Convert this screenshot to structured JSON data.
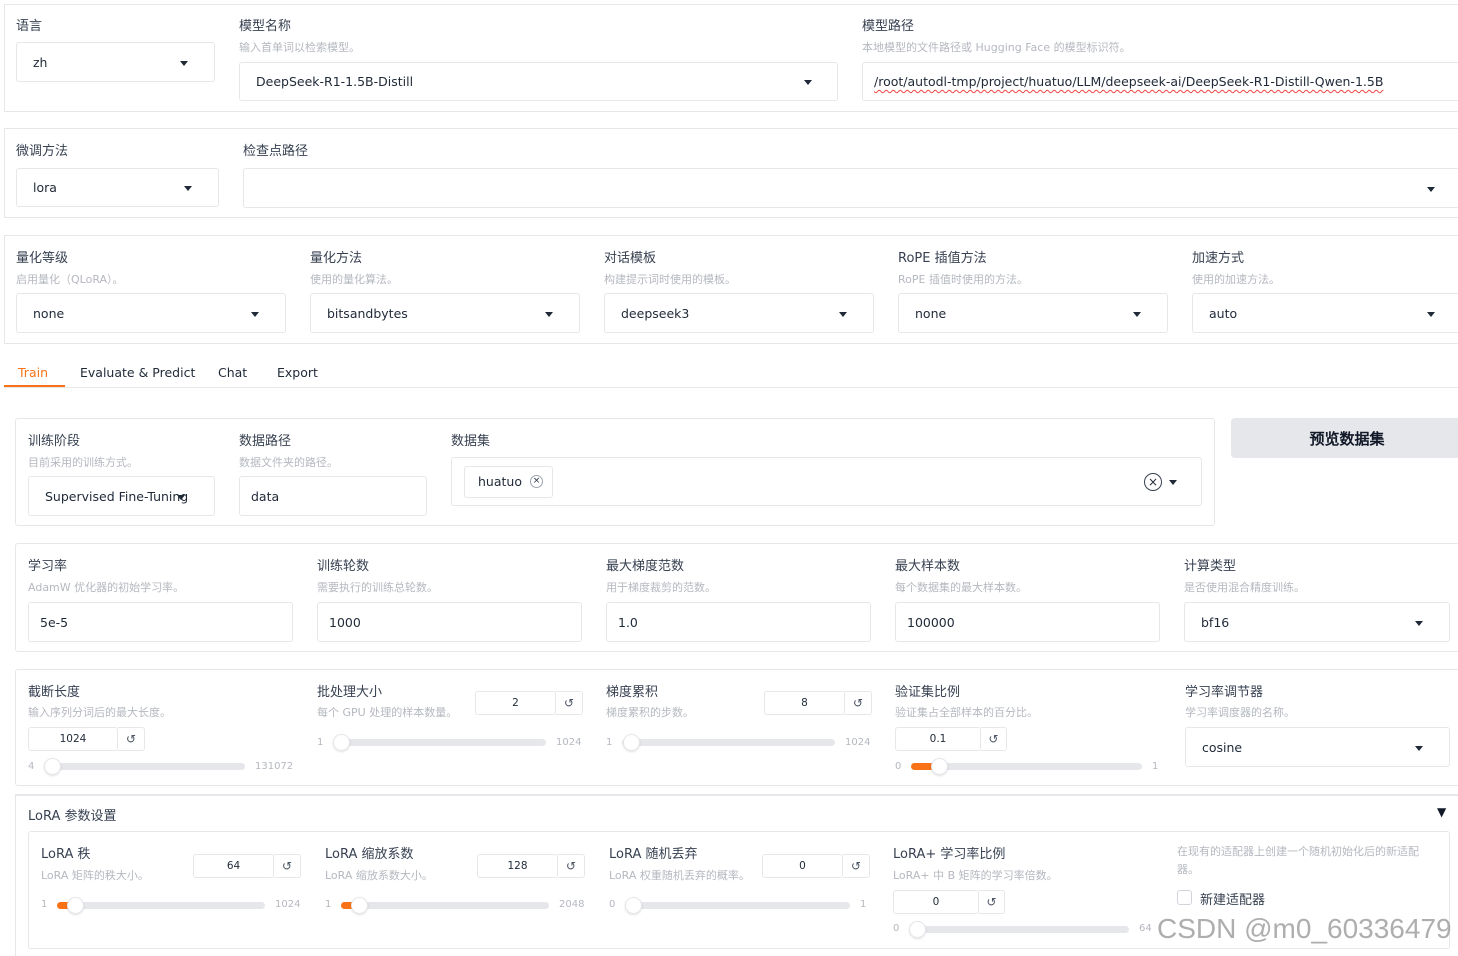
{
  "top": {
    "language": {
      "label": "语言",
      "value": "zh"
    },
    "model_name": {
      "label": "模型名称",
      "hint": "输入首单词以检索模型。",
      "value": "DeepSeek-R1-1.5B-Distill"
    },
    "model_path": {
      "label": "模型路径",
      "hint": "本地模型的文件路径或 Hugging Face 的模型标识符。",
      "value": "/root/autodl-tmp/project/huatuo/LLM/deepseek-ai/DeepSeek-R1-Distill-Qwen-1.5B"
    }
  },
  "finetune": {
    "method": {
      "label": "微调方法",
      "value": "lora"
    },
    "checkpoint": {
      "label": "检查点路径",
      "value": ""
    }
  },
  "advanced": {
    "quant_bit": {
      "label": "量化等级",
      "hint": "启用量化（QLoRA）。",
      "value": "none"
    },
    "quant_method": {
      "label": "量化方法",
      "hint": "使用的量化算法。",
      "value": "bitsandbytes"
    },
    "template": {
      "label": "对话模板",
      "hint": "构建提示词时使用的模板。",
      "value": "deepseek3"
    },
    "rope": {
      "label": "RoPE 插值方法",
      "hint": "RoPE 插值时使用的方法。",
      "value": "none"
    },
    "booster": {
      "label": "加速方式",
      "hint": "使用的加速方法。",
      "value": "auto"
    }
  },
  "tabs": [
    "Train",
    "Evaluate & Predict",
    "Chat",
    "Export"
  ],
  "active_tab": "Train",
  "accent_color": "#f97316",
  "train": {
    "stage": {
      "label": "训练阶段",
      "hint": "目前采用的训练方式。",
      "value": "Supervised Fine-Tuning"
    },
    "dataset_dir": {
      "label": "数据路径",
      "hint": "数据文件夹的路径。",
      "value": "data"
    },
    "dataset": {
      "label": "数据集",
      "chip": "huatuo",
      "chip_close": "×",
      "clear": "×"
    },
    "preview_button": "预览数据集",
    "learning_rate": {
      "label": "学习率",
      "hint": "AdamW 优化器的初始学习率。",
      "value": "5e-5"
    },
    "epochs": {
      "label": "训练轮数",
      "hint": "需要执行的训练总轮数。",
      "value": "1000"
    },
    "max_grad_norm": {
      "label": "最大梯度范数",
      "hint": "用于梯度裁剪的范数。",
      "value": "1.0"
    },
    "max_samples": {
      "label": "最大样本数",
      "hint": "每个数据集的最大样本数。",
      "value": "100000"
    },
    "compute_type": {
      "label": "计算类型",
      "hint": "是否使用混合精度训练。",
      "value": "bf16"
    },
    "cutoff_len": {
      "label": "截断长度",
      "hint": "输入序列分词后的最大长度。",
      "value": "1024",
      "min": "4",
      "max": "131072",
      "fraction": 0.008
    },
    "batch_size": {
      "label": "批处理大小",
      "hint": "每个 GPU 处理的样本数量。",
      "value": "2",
      "min": "1",
      "max": "1024",
      "fraction": 0.001
    },
    "grad_accum": {
      "label": "梯度累积",
      "hint": "梯度累积的步数。",
      "value": "8",
      "min": "1",
      "max": "1024",
      "fraction": 0.007
    },
    "val_size": {
      "label": "验证集比例",
      "hint": "验证集占全部样本的百分比。",
      "value": "0.1",
      "min": "0",
      "max": "1",
      "fraction": 0.1
    },
    "lr_scheduler": {
      "label": "学习率调节器",
      "hint": "学习率调度器的名称。",
      "value": "cosine"
    }
  },
  "lora": {
    "section_title": "LoRA 参数设置",
    "collapse_glyph": "▼",
    "rank": {
      "label": "LoRA 秩",
      "hint": "LoRA 矩阵的秩大小。",
      "value": "64",
      "min": "1",
      "max": "1024",
      "fraction": 0.062
    },
    "alpha": {
      "label": "LoRA 缩放系数",
      "hint": "LoRA 缩放系数大小。",
      "value": "128",
      "min": "1",
      "max": "2048",
      "fraction": 0.062
    },
    "dropout": {
      "label": "LoRA 随机丢弃",
      "hint": "LoRA 权重随机丢弃的概率。",
      "value": "0",
      "min": "0",
      "max": "1",
      "fraction": 0
    },
    "loraplus": {
      "label": "LoRA+ 学习率比例",
      "hint": "LoRA+ 中 B 矩阵的学习率倍数。",
      "value": "0",
      "min": "0",
      "max": "64",
      "fraction": 0
    },
    "create_new": {
      "hint": "在现有的适配器上创建一个随机初始化后的新适配器。",
      "label": "新建适配器"
    }
  },
  "reset_glyph": "↺",
  "watermark": "CSDN @m0_60336479"
}
